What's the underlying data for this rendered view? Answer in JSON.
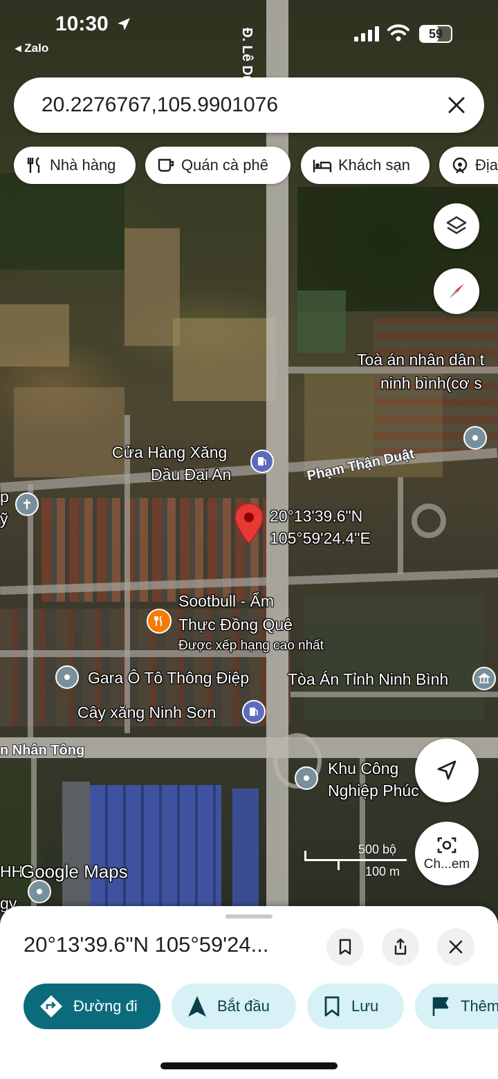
{
  "status_bar": {
    "time": "10:30",
    "back_app": "◂ Zalo",
    "battery": "59",
    "battery_fraction": 0.59
  },
  "search": {
    "value": "20.2276767,105.9901076"
  },
  "chips": [
    {
      "label": "Nhà hàng",
      "icon": "restaurant-icon"
    },
    {
      "label": "Quán cà phê",
      "icon": "coffee-icon"
    },
    {
      "label": "Khách sạn",
      "icon": "hotel-icon"
    },
    {
      "label": "Địa",
      "icon": "attraction-icon"
    }
  ],
  "map": {
    "road_names": {
      "le_duan": "Đ. Lê Duẩn",
      "pham_than_duat": "Phạm Thận Duật",
      "nhan_tong": "n Nhân Tông"
    },
    "places": {
      "toa_an_line1": "Toà án nhân dân t",
      "toa_an_line2": "ninh bình(cơ s",
      "xang_dai_an_line1": "Cửa Hàng Xăng",
      "xang_dai_an_line2": "Dầu Đại An",
      "sootbull_line1": "Sootbull - Ẩm",
      "sootbull_line2": "Thực Đồng Quê",
      "sootbull_rating": "Được xếp hạng cao nhất",
      "gara": "Gara Ô Tô Thông Điệp",
      "toa_an_tinh": "Tòa Án Tỉnh Ninh Bình",
      "cay_xang": "Cây xăng Ninh Sơn",
      "khu_cn_line1": "Khu Công",
      "khu_cn_line2": "Nghiệp Phúc",
      "left_cut_top": "p",
      "left_cut_top2": "ỹ",
      "left_cut_bottom1": "HH",
      "left_cut_bottom2": "gy"
    },
    "pin_coords_line1": "20°13'39.6\"N",
    "pin_coords_line2": "105°59'24.4\"E",
    "scale_top": "500 bộ",
    "scale_bottom": "100 m",
    "watermark": "Google Maps",
    "camera_button_label": "Ch...em"
  },
  "sheet": {
    "title": "20°13'39.6\"N 105°59'24...",
    "actions": [
      {
        "label": "Đường đi",
        "icon": "directions-icon"
      },
      {
        "label": "Bắt đầu",
        "icon": "navigate-icon"
      },
      {
        "label": "Lưu",
        "icon": "bookmark-icon"
      },
      {
        "label": "Thêm",
        "icon": "flag-icon"
      }
    ]
  },
  "colors": {
    "primary_action": "#0b6b7d",
    "secondary_action": "#d8f1f6",
    "pin": "#e53935",
    "poi_blue": "#5c6bc0",
    "poi_orange": "#f57c00",
    "poi_gray": "#78909c"
  }
}
